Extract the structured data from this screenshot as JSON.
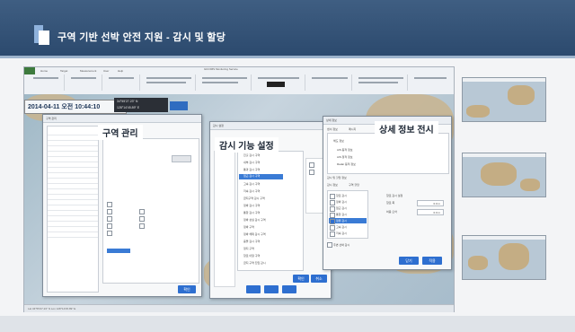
{
  "slide": {
    "title": "구역 기반 선박 안전 지원 - 감시 및 할당"
  },
  "app": {
    "window_title": "GICOMS Monitoring Service",
    "ribbon_tabs": [
      "File",
      "Home",
      "Target",
      "Measurement",
      "User",
      "Help"
    ],
    "datetime": "2014-04-11 오전 10:44:10",
    "coord_lat": "34°55'27.23\" N",
    "coord_lon": "128°14'45.89\" E",
    "status_text": "Lat 34°55'27.23\" N  Lon 128°14'45.89\" E"
  },
  "dialogs": {
    "zone_mgmt": {
      "label": "구역 관리",
      "header": "구역 관리",
      "ok_label": "확인"
    },
    "monitor_settings": {
      "label": "감시 기능 설정",
      "header": "감시 설정",
      "items": [
        "진출 감시 구역",
        "내부 감시 구역",
        "통과 감시 구역",
        "접근 감시 구역",
        "고속 감시 구역",
        "저속 감시 구역",
        "금지구역 감시 구역",
        "정박 감시 구역",
        "통항 감시 구역",
        "정박 상실 감시 구역",
        "정박 구역",
        "정박 해제 감시 구역",
        "충돌 감시 구역",
        "정지 구역",
        "항로 이탈 구역",
        "금지 구역 진입 감시"
      ],
      "selected_index": 3,
      "ok_label": "확인",
      "cancel_label": "취소"
    },
    "detail_info": {
      "label": "상세 정보 전시",
      "header": "상세 정보",
      "tabs": [
        "센서 정보",
        "메시지"
      ],
      "info_items": [
        "해도 정보",
        "AIS 동적 정보",
        "AIS 정적 정보",
        "Radar 동적 정보"
      ],
      "section_zone": "감시 및 할당 정보",
      "zone_tabs": [
        "감시 정보",
        "구역 할당"
      ],
      "list_items": [
        "항로 감시",
        "정박 감시",
        "접근 감시",
        "통항 감시",
        "정류 감시",
        "고속 감시",
        "저속 감시"
      ],
      "selected_index": 4,
      "setting_title": "항로 감시 설정",
      "field_1_label": "항로 폭",
      "field_1_value": "0.0 m",
      "field_2_label": "허용 오차",
      "field_2_value": "0.0 m",
      "footer_check": "주변 선박 감시",
      "apply_label": "닫기",
      "cancel_label": "적용"
    }
  }
}
